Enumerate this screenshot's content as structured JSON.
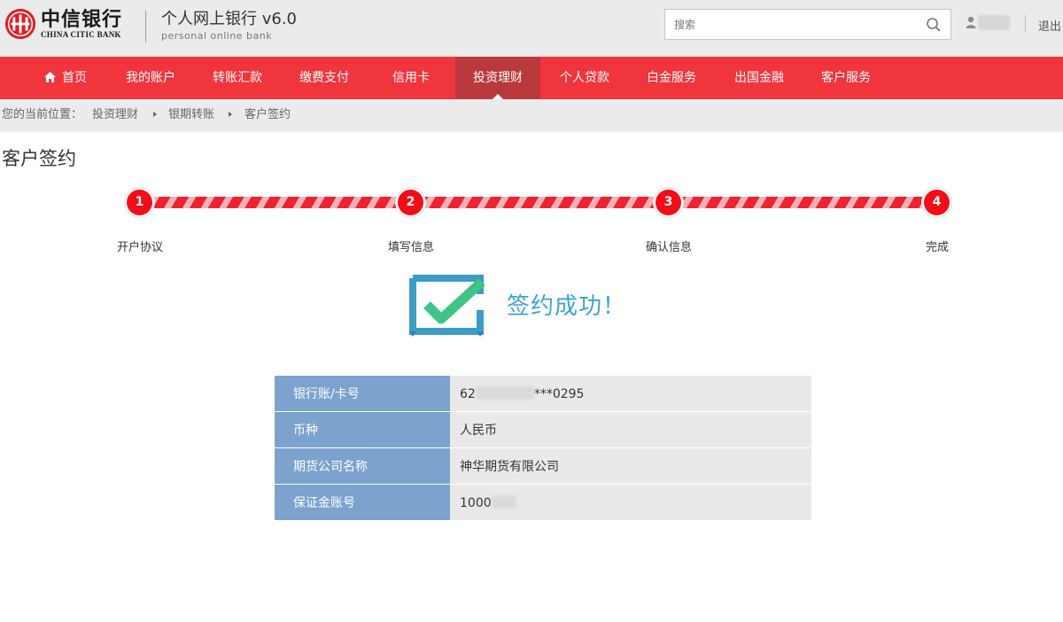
{
  "brand": {
    "name_cn": "中信银行",
    "name_en": "CHINA CITIC BANK",
    "app_title": "个人网上银行 v6.0",
    "app_subtitle": "personal online bank",
    "brand_color": "#f0353c"
  },
  "header": {
    "search_placeholder": "搜索",
    "logout_label": "退出"
  },
  "nav": {
    "items": [
      {
        "label": "首页",
        "icon": "home-icon"
      },
      {
        "label": "我的账户"
      },
      {
        "label": "转账汇款"
      },
      {
        "label": "缴费支付"
      },
      {
        "label": "信用卡"
      },
      {
        "label": "投资理财",
        "active": true
      },
      {
        "label": "个人贷款"
      },
      {
        "label": "白金服务"
      },
      {
        "label": "出国金融"
      },
      {
        "label": "客户服务"
      }
    ]
  },
  "breadcrumb": {
    "prefix": "您的当前位置：",
    "items": [
      "投资理财",
      "银期转账",
      "客户签约"
    ]
  },
  "page": {
    "title": "客户签约"
  },
  "steps": [
    {
      "number": "1",
      "label": "开户协议"
    },
    {
      "number": "2",
      "label": "填写信息"
    },
    {
      "number": "3",
      "label": "确认信息"
    },
    {
      "number": "4",
      "label": "完成"
    }
  ],
  "result": {
    "message": "签约成功！",
    "icon": "checkmark-icon"
  },
  "details": [
    {
      "label": "银行账/卡号",
      "value_start": "62",
      "value_end": "***0295"
    },
    {
      "label": "币种",
      "value": "人民币"
    },
    {
      "label": "期货公司名称",
      "value": "神华期货有限公司"
    },
    {
      "label": "保证金账号",
      "value_start": "1000"
    }
  ]
}
